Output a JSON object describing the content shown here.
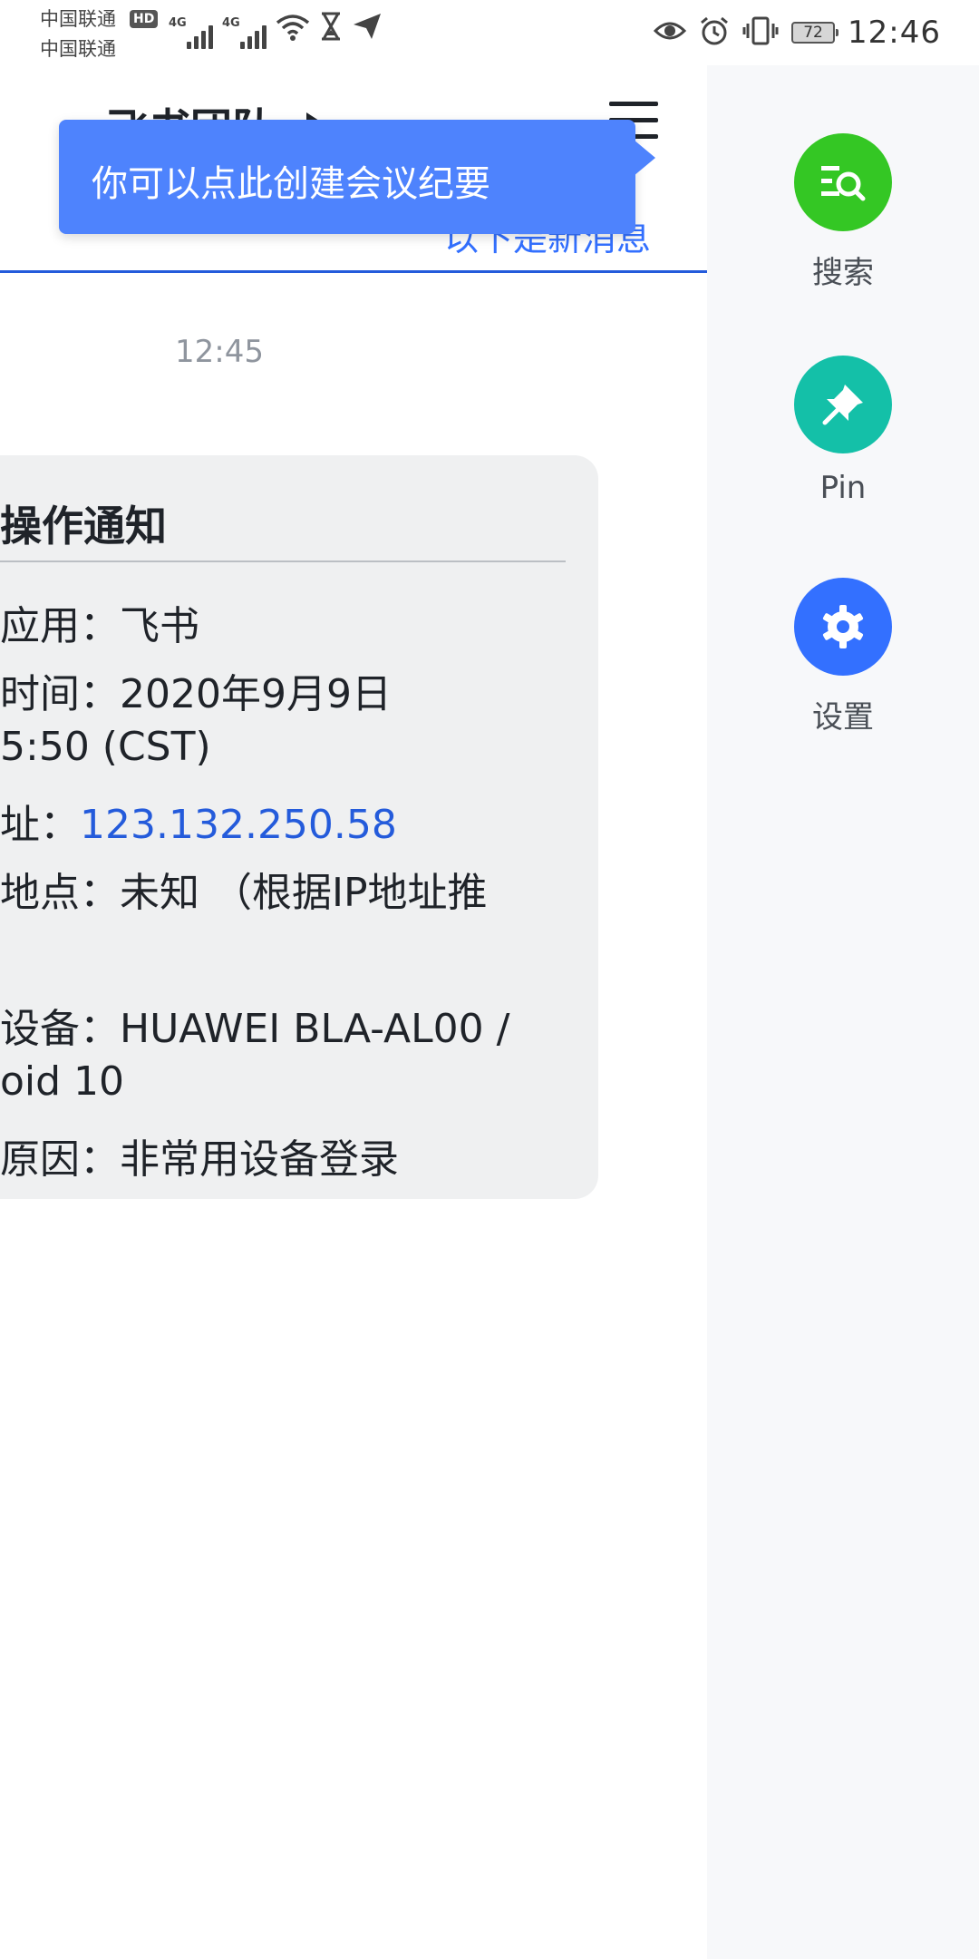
{
  "status_bar": {
    "carrier_1": "中国联通",
    "carrier_2": "中国联通",
    "hd": "HD",
    "net_1": "4G",
    "net_2": "4G",
    "battery": "72",
    "time": "12:46"
  },
  "chat": {
    "title": "飞书团队",
    "tooltip": "你可以点此创建会议纪要",
    "new_messages_label": "以下是新消息",
    "timestamp": "12:45"
  },
  "card": {
    "title": "操作通知",
    "lines": [
      "应用：飞书",
      "时间：2020年9月9日",
      "5:50 (CST)",
      "址：",
      "地点：未知 （根据IP地址推",
      "设备：HUAWEI BLA-AL00 /",
      "oid 10",
      "原因：非常用设备登录"
    ],
    "ip": "123.132.250.58"
  },
  "drawer": {
    "items": [
      {
        "label": "搜索",
        "icon": "search-doc-icon",
        "color": "#34c724"
      },
      {
        "label": "Pin",
        "icon": "pin-icon",
        "color": "#14c0a8"
      },
      {
        "label": "设置",
        "icon": "gear-icon",
        "color": "#3370ff"
      }
    ]
  }
}
